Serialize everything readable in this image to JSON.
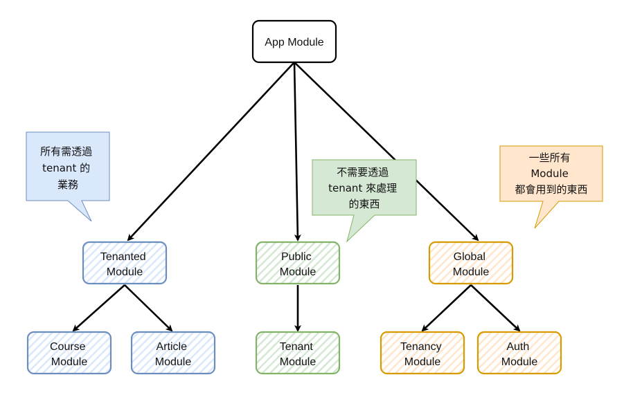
{
  "diagram": {
    "root": {
      "label": "App Module"
    },
    "branches": [
      {
        "id": "tenanted",
        "label": [
          "Tenanted",
          "Module"
        ],
        "color": "#6c8ebf",
        "fill": "#dae8fc",
        "children": [
          {
            "label": [
              "Course",
              "Module"
            ]
          },
          {
            "label": [
              "Article",
              "Module"
            ]
          }
        ],
        "callout": {
          "lines": [
            "所有需透過",
            "tenant 的",
            "業務"
          ]
        }
      },
      {
        "id": "public",
        "label": [
          "Public",
          "Module"
        ],
        "color": "#82b366",
        "fill": "#d5e8d4",
        "children": [
          {
            "label": [
              "Tenant",
              "Module"
            ]
          }
        ],
        "callout": {
          "lines": [
            "不需要透過",
            "tenant 來處理",
            "的東西"
          ]
        }
      },
      {
        "id": "global",
        "label": [
          "Global",
          "Module"
        ],
        "color": "#d79b00",
        "fill": "#ffe6cc",
        "children": [
          {
            "label": [
              "Tenancy",
              "Module"
            ]
          },
          {
            "label": [
              "Auth",
              "Module"
            ]
          }
        ],
        "callout": {
          "lines": [
            "一些所有",
            "Module",
            "都會用到的東西"
          ]
        }
      }
    ]
  }
}
